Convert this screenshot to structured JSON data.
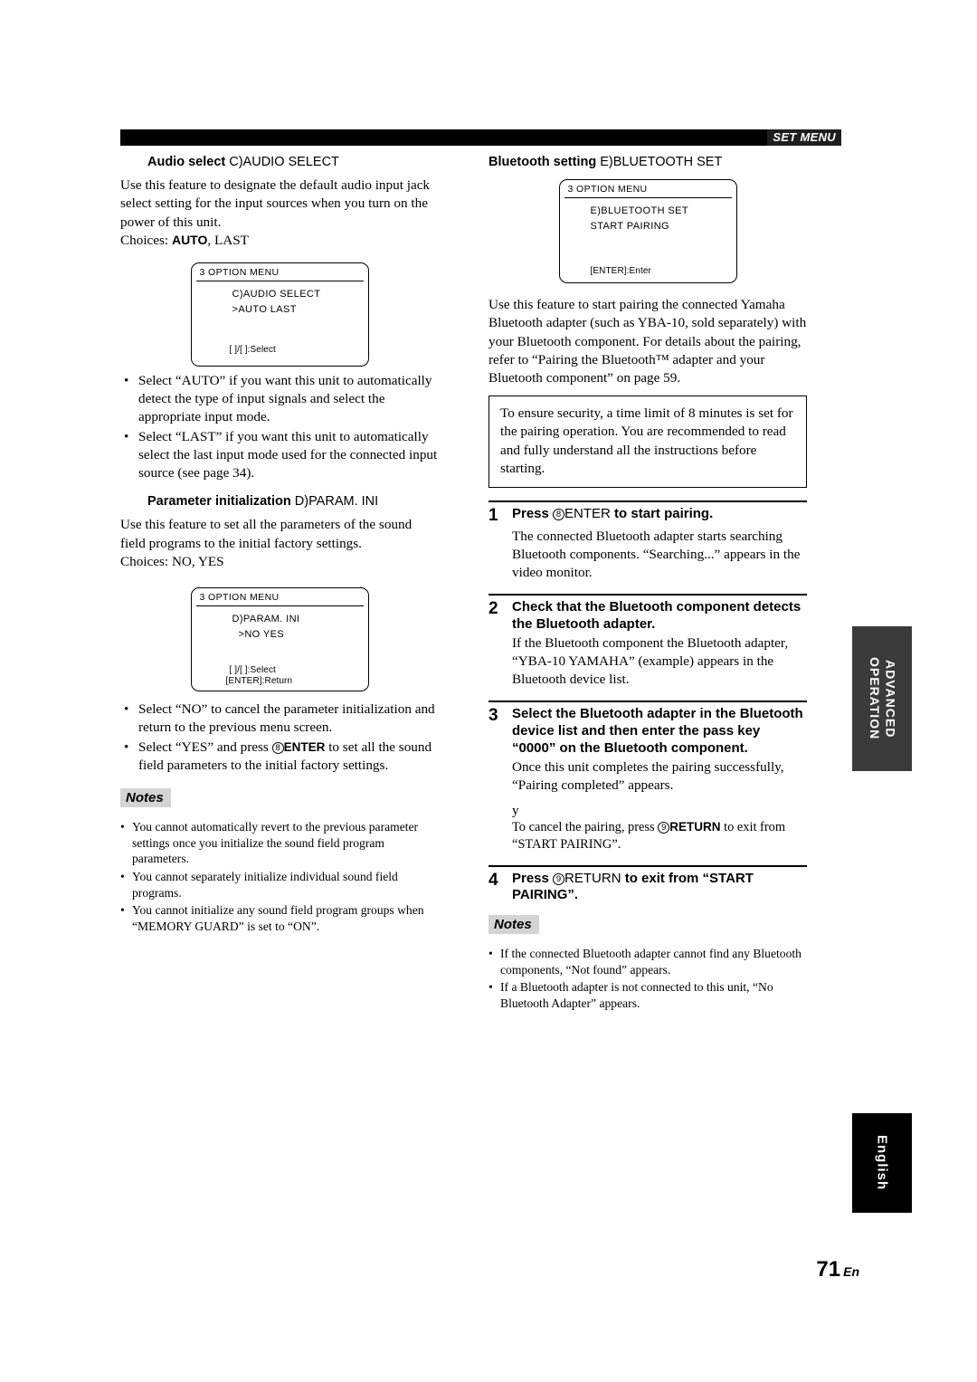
{
  "header": {
    "label": "SET MENU"
  },
  "left_column": {
    "section1": {
      "heading_name": "Audio select",
      "heading_code": "C)AUDIO SELECT",
      "paragraph": "Use this feature to designate the default audio input jack select setting for the input sources when you turn on the power of this unit.",
      "choices_label": "Choices:",
      "choices_bold": "AUTO",
      "choices_rest": ", LAST",
      "osd": {
        "title": "3  OPTION  MENU",
        "line1": "C)AUDIO  SELECT",
        "line2": ">AUTO   LAST",
        "footer1": "[ ]/[ ]:Select",
        "footer2": ""
      },
      "bullets": [
        "Select “AUTO” if you want this unit to automatically detect the type of input signals and select the appropriate input mode.",
        "Select “LAST” if you want this unit to automatically select the last input mode used for the connected input source (see page 34)."
      ]
    },
    "section2": {
      "heading_name": "Parameter initialization",
      "heading_code": "D)PARAM. INI",
      "paragraph": "Use this feature to set all the parameters of the sound field programs to the initial factory settings.",
      "choices_label": "Choices:",
      "choices_rest": " NO, YES",
      "osd": {
        "title": "3  OPTION  MENU",
        "line1": "D)PARAM.  INI",
        "line2": ">NO        YES",
        "footer1": "[ ]/[ ]:Select",
        "footer2": "[ENTER]:Return"
      },
      "bullets": [
        "Select “NO” to cancel the parameter initialization and return to the previous menu screen.",
        "Select “YES” and press ⑧8ENTER to set all the sound field parameters to the initial factory settings."
      ],
      "bullet2_pre": "Select “YES” and press ",
      "bullet2_num": "8",
      "bullet2_key": "ENTER",
      "bullet2_post": " to set all the sound field parameters to the initial factory settings."
    },
    "notes": {
      "title": "Notes",
      "items": [
        "You cannot automatically revert to the previous parameter settings once you initialize the sound field program parameters.",
        "You cannot separately initialize individual sound field programs.",
        "You cannot initialize any sound field program groups when “MEMORY GUARD” is set to “ON”."
      ]
    }
  },
  "right_column": {
    "heading_name": "Bluetooth setting",
    "heading_code": "E)BLUETOOTH SET",
    "osd": {
      "title": "3  OPTION  MENU",
      "line1": "E)BLUETOOTH  SET",
      "line2": "START  PAIRING",
      "footer1": "[ENTER]:Enter"
    },
    "paragraph": "Use this feature to start pairing the connected Yamaha Bluetooth adapter (such as YBA-10, sold separately) with your Bluetooth component. For details about the pairing, refer to “Pairing the Bluetooth™ adapter and your Bluetooth component” on page 59.",
    "infobox": "To ensure security, a time limit of 8 minutes is set for the pairing operation. You are recommended to read and fully understand all the instructions before starting.",
    "steps": [
      {
        "num": "1",
        "head_pre": "Press ",
        "head_circ": "8",
        "head_key": "ENTER",
        "head_post": "  to start pairing.",
        "body": "The connected Bluetooth adapter starts searching Bluetooth components. “Searching...” appears in the video monitor."
      },
      {
        "num": "2",
        "head_pre": "Check that the Bluetooth component detects the Bluetooth adapter.",
        "head_circ": "",
        "head_key": "",
        "head_post": "",
        "body": "If the Bluetooth component the Bluetooth adapter, “YBA-10 YAMAHA” (example) appears in the Bluetooth device list."
      },
      {
        "num": "3",
        "head_pre": "Select the Bluetooth adapter in the Bluetooth device list and then enter the pass key “0000” on the Bluetooth component.",
        "head_circ": "",
        "head_key": "",
        "head_post": "",
        "body": "Once this unit completes the pairing successfully, “Pairing completed” appears."
      }
    ],
    "stray_glyph": "y",
    "cancel_note_pre": "To cancel the pairing, press ",
    "cancel_note_num": "9",
    "cancel_note_key": "RETURN",
    "cancel_note_post": " to exit from “START PAIRING”.",
    "step4": {
      "num": "4",
      "head_pre": "Press ",
      "head_circ": "9",
      "head_key": "RETURN",
      "head_post": "  to exit from “START PAIRING”."
    },
    "notes": {
      "title": "Notes",
      "items": [
        "If the connected Bluetooth adapter cannot find any Bluetooth components, “Not found” appears.",
        "If a Bluetooth adapter is not connected to this unit, “No Bluetooth Adapter” appears."
      ]
    }
  },
  "side_tabs": {
    "advanced": "ADVANCED OPERATION",
    "language": "English"
  },
  "page_number": {
    "number": "71",
    "suffix": "En"
  }
}
